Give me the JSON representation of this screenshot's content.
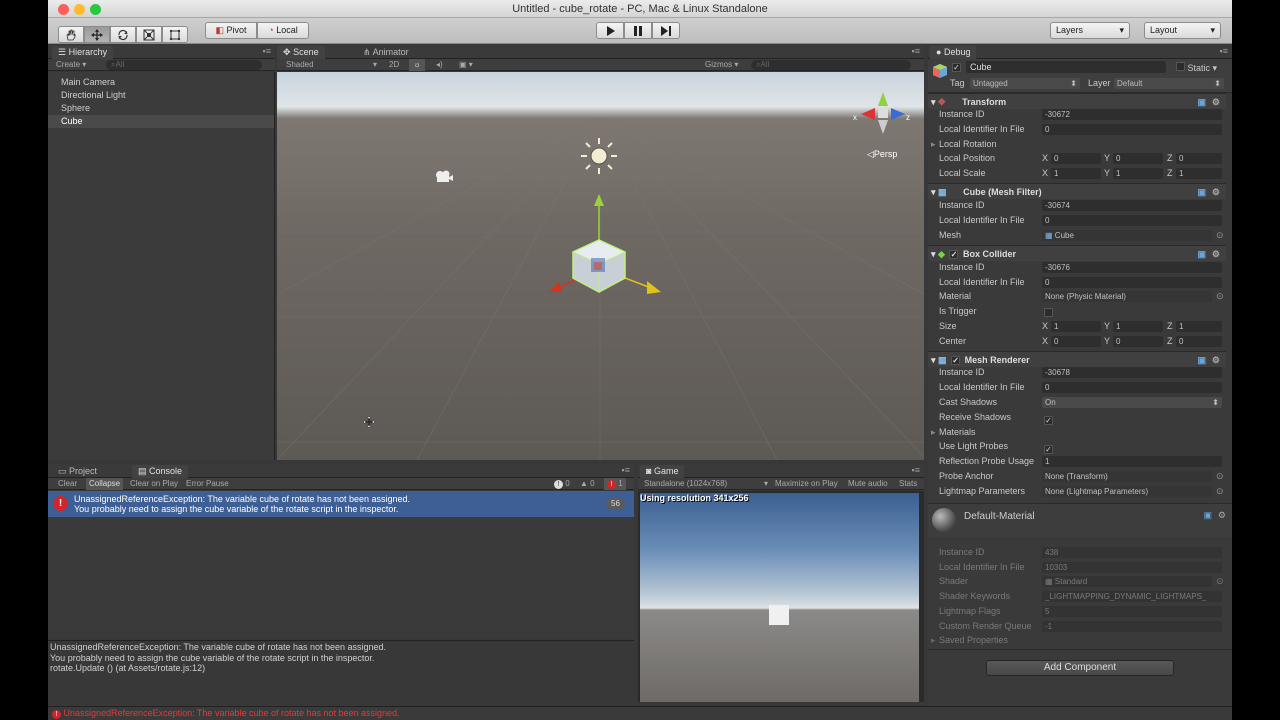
{
  "window": {
    "title": "Untitled - cube_rotate - PC, Mac & Linux Standalone"
  },
  "toolbar": {
    "pivot_label": "Pivot",
    "local_label": "Local",
    "layers_label": "Layers",
    "layout_label": "Layout"
  },
  "hierarchy": {
    "tab": "Hierarchy",
    "create_label": "Create",
    "search_placeholder": "All",
    "items": [
      {
        "label": "Main Camera"
      },
      {
        "label": "Directional Light"
      },
      {
        "label": "Sphere"
      },
      {
        "label": "Cube"
      }
    ]
  },
  "scene": {
    "tab_scene": "Scene",
    "tab_animator": "Animator",
    "shading": "Shaded",
    "mode_2d": "2D",
    "gizmos": "Gizmos",
    "search_placeholder": "All",
    "persp_label": "Persp",
    "gizmo_x": "x",
    "gizmo_z": "z"
  },
  "console": {
    "tab_project": "Project",
    "tab_console": "Console",
    "clear": "Clear",
    "collapse": "Collapse",
    "clear_on_play": "Clear on Play",
    "error_pause": "Error Pause",
    "info_count": "0",
    "warn_count": "0",
    "error_count": "1",
    "message_line1": "UnassignedReferenceException: The variable cube of rotate has not been assigned.",
    "message_line2": "You probably need to assign the cube variable of the rotate script in the inspector.",
    "message_count": "56",
    "detail_line1": "UnassignedReferenceException: The variable cube of rotate has not been assigned.",
    "detail_line2": "You probably need to assign the cube variable of the rotate script in the inspector.",
    "detail_line3": "rotate.Update () (at Assets/rotate.js:12)",
    "status_message": "UnassignedReferenceException: The variable cube of rotate has not been assigned."
  },
  "game": {
    "tab": "Game",
    "resolution_select": "Standalone (1024x768)",
    "maximize": "Maximize on Play",
    "mute": "Mute audio",
    "stats": "Stats",
    "resolution_note": "Using resolution 341x256"
  },
  "inspector": {
    "tab": "Debug",
    "object_name": "Cube",
    "static_label": "Static",
    "tag_label": "Tag",
    "tag_value": "Untagged",
    "layer_label": "Layer",
    "layer_value": "Default",
    "transform": {
      "title": "Transform",
      "instance_id_label": "Instance ID",
      "instance_id": "-30672",
      "local_identifier_label": "Local Identifier In File",
      "local_identifier": "0",
      "local_rotation_label": "Local Rotation",
      "local_position_label": "Local Position",
      "pos_x": "0",
      "pos_y": "0",
      "pos_z": "0",
      "local_scale_label": "Local Scale",
      "scale_x": "1",
      "scale_y": "1",
      "scale_z": "1"
    },
    "mesh_filter": {
      "title": "Cube (Mesh Filter)",
      "instance_id_label": "Instance ID",
      "instance_id": "-30674",
      "local_identifier_label": "Local Identifier In File",
      "local_identifier": "0",
      "mesh_label": "Mesh",
      "mesh_value": "Cube"
    },
    "box_collider": {
      "title": "Box Collider",
      "instance_id_label": "Instance ID",
      "instance_id": "-30676",
      "local_identifier_label": "Local Identifier In File",
      "local_identifier": "0",
      "material_label": "Material",
      "material_value": "None (Physic Material)",
      "is_trigger_label": "Is Trigger",
      "size_label": "Size",
      "size_x": "1",
      "size_y": "1",
      "size_z": "1",
      "center_label": "Center",
      "center_x": "0",
      "center_y": "0",
      "center_z": "0"
    },
    "mesh_renderer": {
      "title": "Mesh Renderer",
      "instance_id_label": "Instance ID",
      "instance_id": "-30678",
      "local_identifier_label": "Local Identifier In File",
      "local_identifier": "0",
      "cast_shadows_label": "Cast Shadows",
      "cast_shadows_value": "On",
      "receive_shadows_label": "Receive Shadows",
      "materials_label": "Materials",
      "use_light_probes_label": "Use Light Probes",
      "reflection_probe_label": "Reflection Probe Usage",
      "reflection_probe_value": "1",
      "probe_anchor_label": "Probe Anchor",
      "probe_anchor_value": "None (Transform)",
      "lightmap_params_label": "Lightmap Parameters",
      "lightmap_params_value": "None (Lightmap Parameters)"
    },
    "material": {
      "title": "Default-Material",
      "instance_id_label": "Instance ID",
      "instance_id": "438",
      "local_identifier_label": "Local Identifier In File",
      "local_identifier": "10303",
      "shader_label": "Shader",
      "shader_value": "Standard",
      "shader_keywords_label": "Shader Keywords",
      "shader_keywords_value": "_LIGHTMAPPING_DYNAMIC_LIGHTMAPS_",
      "lightmap_flags_label": "Lightmap Flags",
      "lightmap_flags_value": "5",
      "custom_render_queue_label": "Custom Render Queue",
      "custom_render_queue_value": "-1",
      "saved_properties_label": "Saved Properties"
    },
    "add_component_label": "Add Component"
  },
  "colors": {
    "selection_blue": "#3e5f96",
    "error_red": "#d0262b",
    "play_bar": "#c6c6c6"
  }
}
